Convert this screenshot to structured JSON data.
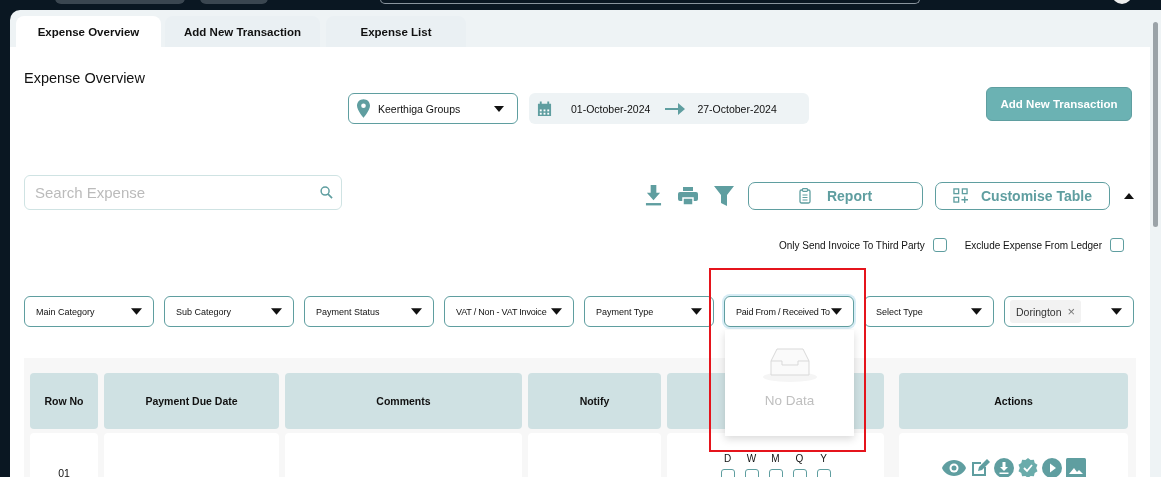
{
  "tabs": [
    {
      "label": "Expense Overview",
      "selected": true
    },
    {
      "label": "Add New Transaction",
      "selected": false
    },
    {
      "label": "Expense List",
      "selected": false
    }
  ],
  "page_title": "Expense Overview",
  "location": {
    "value": "Keerthiga Groups"
  },
  "date_range": {
    "from": "01-October-2024",
    "to": "27-October-2024"
  },
  "add_button": "Add New Transaction",
  "search": {
    "placeholder": "Search Expense"
  },
  "toolbar": {
    "report": "Report",
    "customise": "Customise Table"
  },
  "options": [
    {
      "label": "Only Send Invoice To Third Party",
      "checked": false
    },
    {
      "label": "Exclude Expense From Ledger",
      "checked": false
    }
  ],
  "filters": [
    {
      "placeholder": "Main Category",
      "open": false
    },
    {
      "placeholder": "Sub Category",
      "open": false
    },
    {
      "placeholder": "Payment Status",
      "open": false
    },
    {
      "placeholder": "VAT / Non - VAT Invoice",
      "open": false
    },
    {
      "placeholder": "Payment Type",
      "open": false
    },
    {
      "placeholder": "Paid From / Received To",
      "open": true,
      "empty_text": "No Data"
    },
    {
      "placeholder": "Select Type",
      "open": false
    },
    {
      "chips": [
        {
          "label": "Dorington",
          "remove": "×"
        }
      ],
      "open": false
    }
  ],
  "table": {
    "columns": [
      {
        "label": "Row No"
      },
      {
        "label": "Payment Due Date"
      },
      {
        "label": "Comments"
      },
      {
        "label": "Notify"
      },
      {},
      {
        "label": "Actions"
      }
    ],
    "rows": [
      {
        "row_no": "01",
        "frequency": [
          {
            "label": "D",
            "checked": false
          },
          {
            "label": "W",
            "checked": false
          },
          {
            "label": "M",
            "checked": false
          },
          {
            "label": "Q",
            "checked": false
          },
          {
            "label": "Y",
            "checked": false
          }
        ]
      }
    ]
  },
  "annotation": {
    "kind": "highlight-box"
  }
}
